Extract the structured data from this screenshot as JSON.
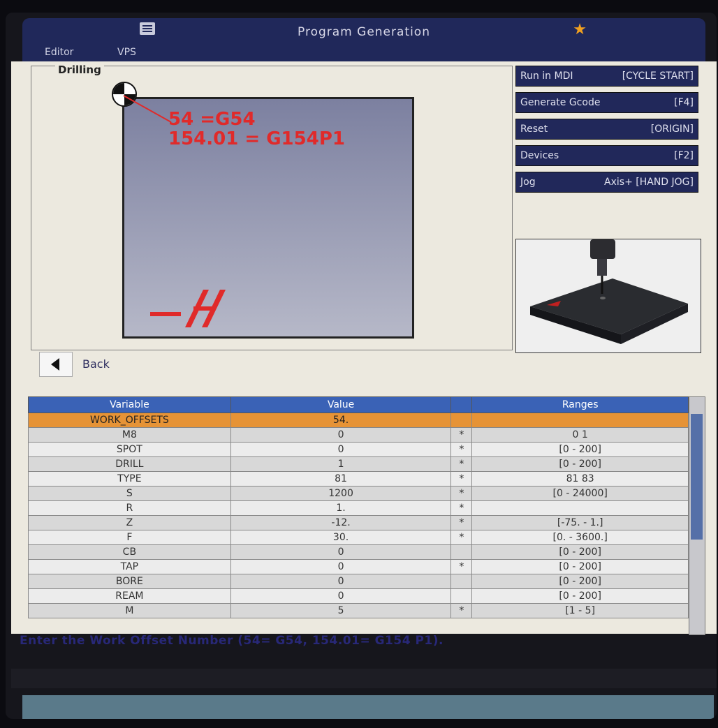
{
  "app": {
    "title": "Program Generation",
    "star": "★"
  },
  "menu": {
    "items": [
      "Editor",
      "VPS"
    ]
  },
  "panel": {
    "title": "Drilling",
    "annotation_line1": "54 =G54",
    "annotation_line2": "154.01 = G154P1",
    "logo_text": "H"
  },
  "buttons": [
    {
      "label": "Run in MDI",
      "key": "[CYCLE START]"
    },
    {
      "label": "Generate Gcode",
      "key": "[F4]"
    },
    {
      "label": "Reset",
      "key": "[ORIGIN]"
    },
    {
      "label": "Devices",
      "key": "[F2]"
    },
    {
      "label": "Jog",
      "key": "Axis+ [HAND JOG]"
    }
  ],
  "nav": {
    "back_label": "Back"
  },
  "table": {
    "headers": [
      "Variable",
      "Value",
      "",
      "Ranges"
    ],
    "rows": [
      {
        "variable": "WORK_OFFSETS",
        "value": "54.",
        "flag": "",
        "range": ""
      },
      {
        "variable": "M8",
        "value": "0",
        "flag": "*",
        "range": "0 1"
      },
      {
        "variable": "SPOT",
        "value": "0",
        "flag": "*",
        "range": "[0 - 200]"
      },
      {
        "variable": "DRILL",
        "value": "1",
        "flag": "*",
        "range": "[0 - 200]"
      },
      {
        "variable": "TYPE",
        "value": "81",
        "flag": "*",
        "range": "81 83"
      },
      {
        "variable": "S",
        "value": "1200",
        "flag": "*",
        "range": "[0 - 24000]"
      },
      {
        "variable": "R",
        "value": "1.",
        "flag": "*",
        "range": ""
      },
      {
        "variable": "Z",
        "value": "-12.",
        "flag": "*",
        "range": "[-75. - 1.]"
      },
      {
        "variable": "F",
        "value": "30.",
        "flag": "*",
        "range": "[0. - 3600.]"
      },
      {
        "variable": "CB",
        "value": "0",
        "flag": "",
        "range": "[0 - 200]"
      },
      {
        "variable": "TAP",
        "value": "0",
        "flag": "*",
        "range": "[0 - 200]"
      },
      {
        "variable": "BORE",
        "value": "0",
        "flag": "",
        "range": "[0 - 200]"
      },
      {
        "variable": "REAM",
        "value": "0",
        "flag": "",
        "range": "[0 - 200]"
      },
      {
        "variable": "M",
        "value": "5",
        "flag": "*",
        "range": "[1 - 5]"
      }
    ]
  },
  "status": {
    "message": "Enter the Work Offset Number (54= G54, 154.01= G154 P1)."
  },
  "colors": {
    "accent": "#20285a",
    "highlight": "#e69336",
    "header": "#3a62b6",
    "annotation": "#e02a2a"
  }
}
